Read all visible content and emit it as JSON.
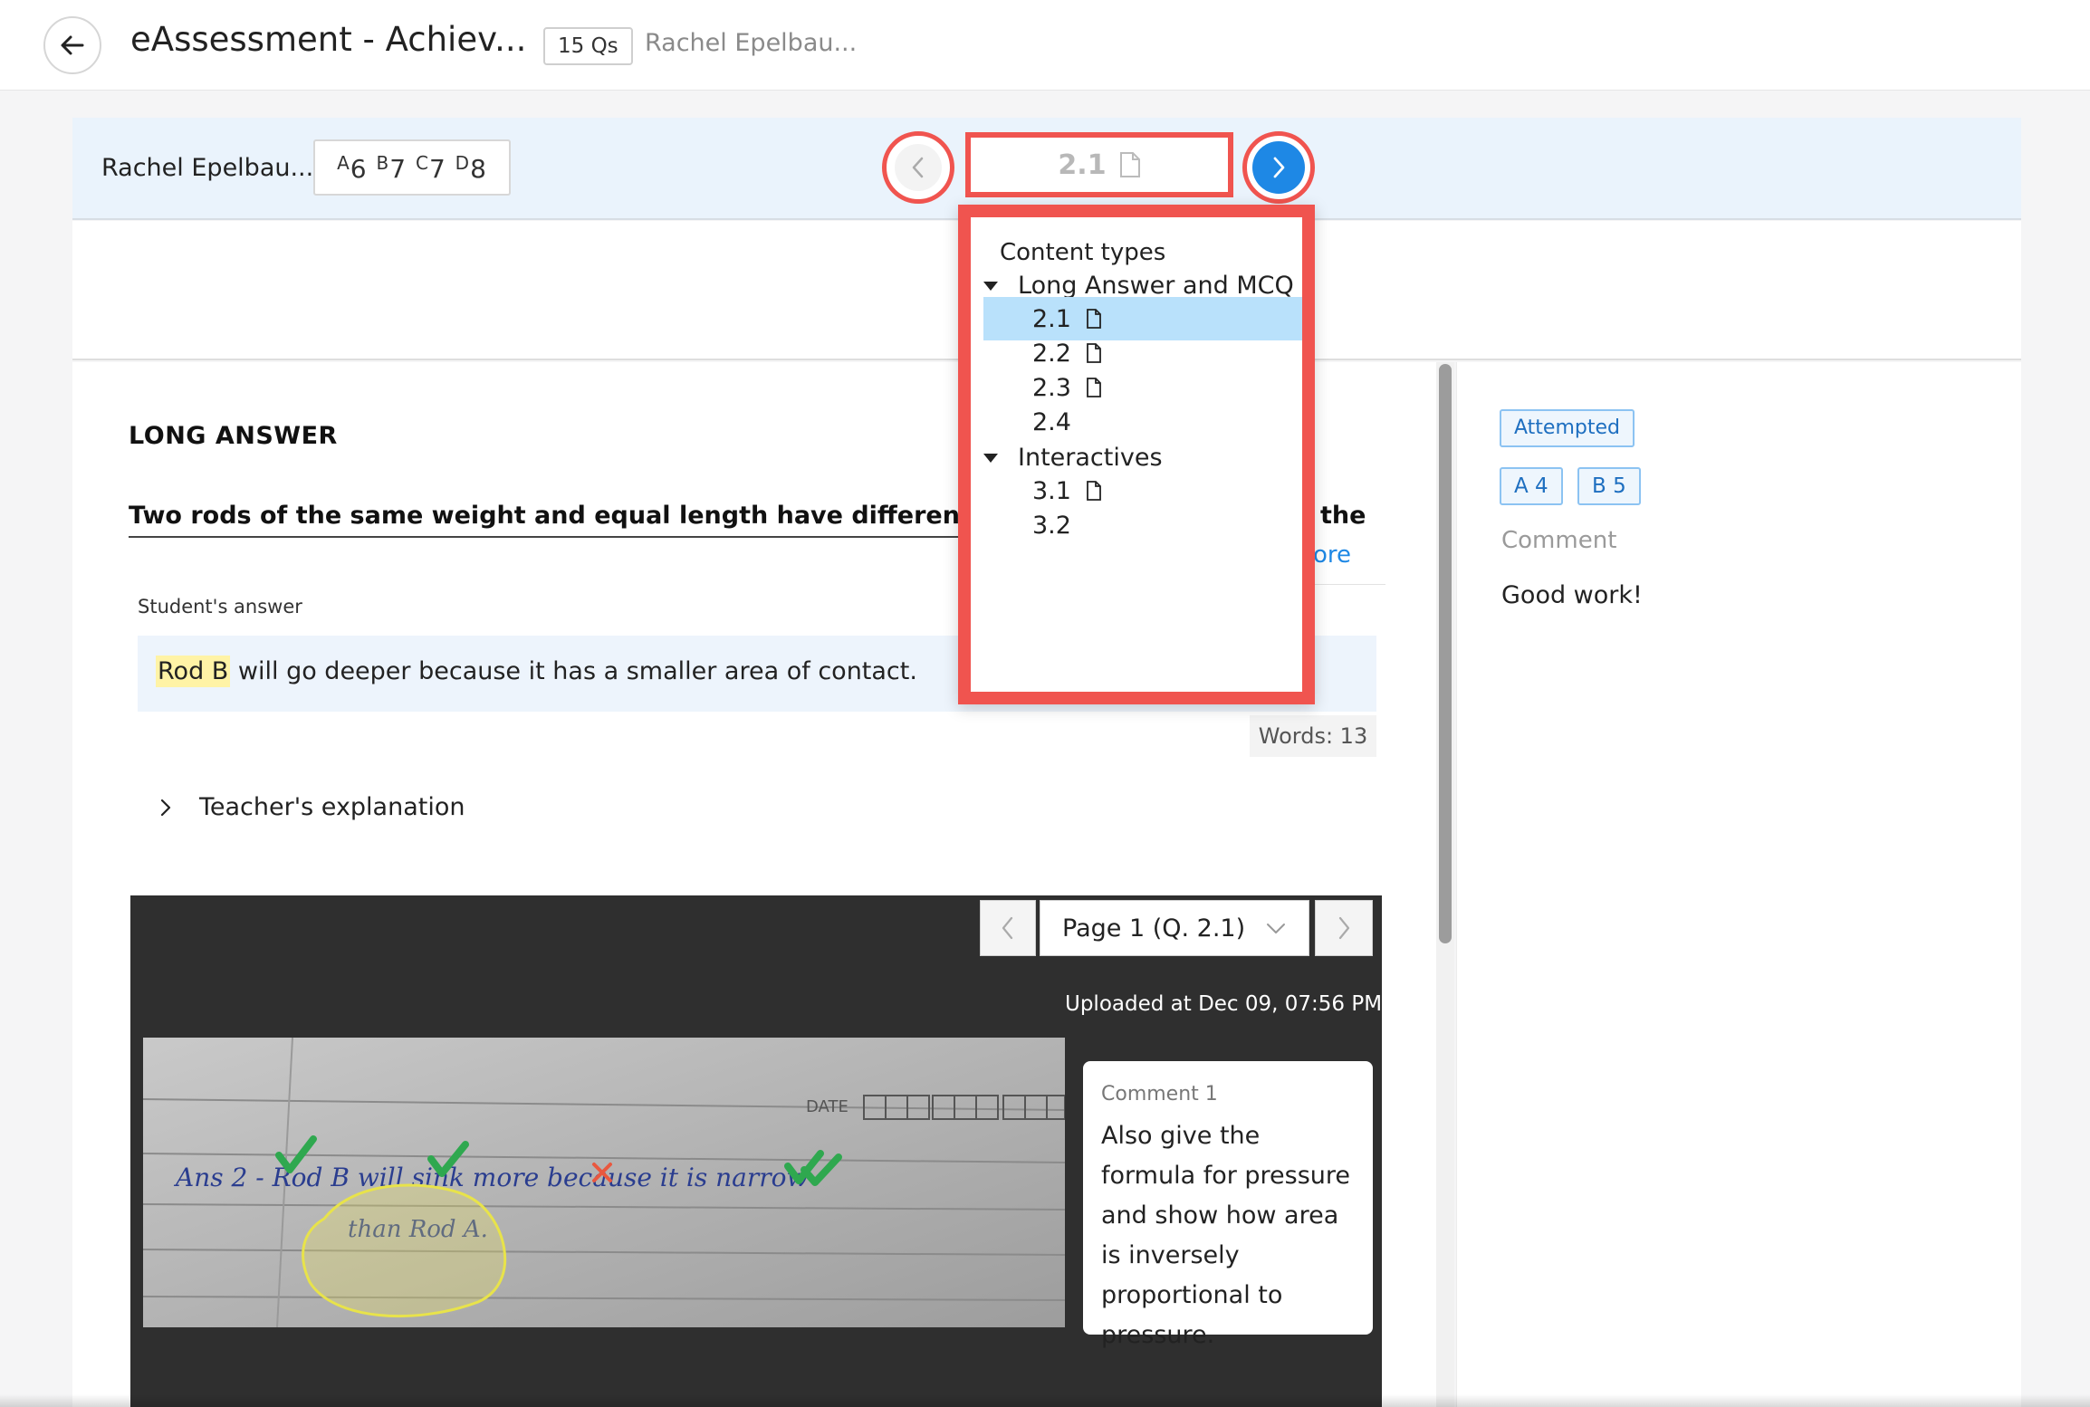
{
  "header": {
    "title": "eAssessment - Achiev...",
    "question_count": "15 Qs",
    "student": "Rachel Epelbau..."
  },
  "student_strip": {
    "name": "Rachel Epelbau...",
    "grades": [
      {
        "letter": "A",
        "value": "6"
      },
      {
        "letter": "B",
        "value": "7"
      },
      {
        "letter": "C",
        "value": "7"
      },
      {
        "letter": "D",
        "value": "8"
      }
    ],
    "current_question": "2.1"
  },
  "dropdown": {
    "heading": "Content types",
    "groups": [
      {
        "label": "Long Answer and MCQ",
        "items": [
          "2.1",
          "2.2",
          "2.3",
          "2.4"
        ]
      },
      {
        "label": "Interactives",
        "items": [
          "3.1",
          "3.2"
        ]
      }
    ],
    "selected": "2.1"
  },
  "question": {
    "type": "LONG ANSWER",
    "text": "Two rods of the same weight and equal length have different thickness",
    "text_end": "the",
    "read_more": "ore"
  },
  "answer": {
    "label": "Student's answer",
    "highlight": "Rod B",
    "rest": " will go deeper because it has a smaller area of contact.",
    "word_count": "Words: 13"
  },
  "explanation": {
    "label": "Teacher's explanation"
  },
  "viewer": {
    "page_select": "Page 1 (Q. 2.1)",
    "uploaded": "Uploaded at Dec 09, 07:56 PM",
    "photo": {
      "handwriting_line1": "Ans 2 -   Rod B will sink more because it is narrow",
      "handwriting_line2": "than  Rod A.",
      "date_label": "DATE"
    },
    "comment": {
      "title": "Comment 1",
      "body": "Also give the formula for pressure and show how area is inversely proportional to pressure."
    }
  },
  "side": {
    "status": "Attempted",
    "score_a": "A 4",
    "score_b": "B 5",
    "comment_label": "Comment",
    "comment_value": "Good work!"
  },
  "colors": {
    "accent": "#1e88e5",
    "annotation_red": "#f0544f",
    "selection": "#b9e1fb"
  }
}
